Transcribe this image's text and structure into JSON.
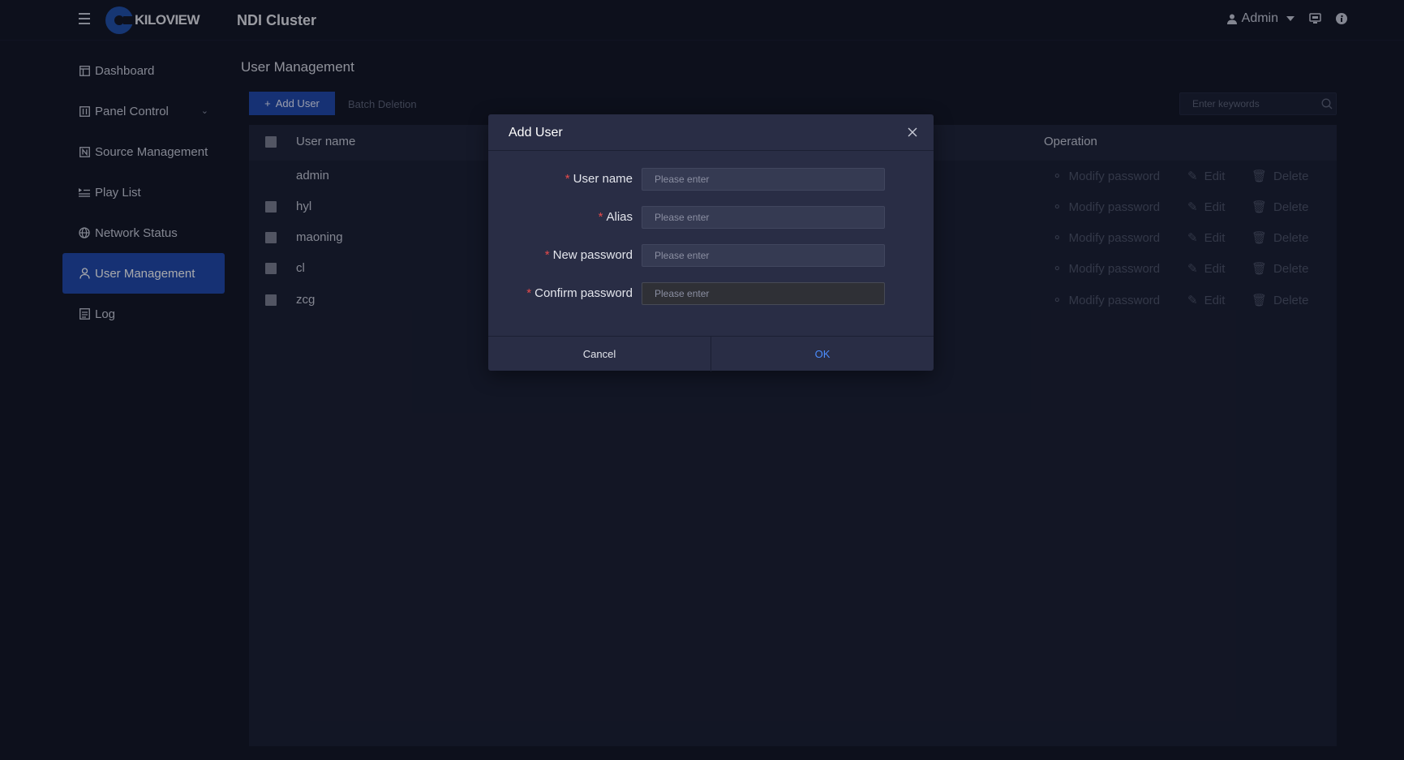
{
  "header": {
    "logo_text": "KILOVIEW",
    "app_title": "NDI Cluster",
    "user_label": "Admin"
  },
  "sidebar": {
    "items": [
      {
        "label": "Dashboard",
        "icon": "dashboard-icon"
      },
      {
        "label": "Panel Control",
        "icon": "panel-icon",
        "has_submenu": true
      },
      {
        "label": "Source Management",
        "icon": "source-icon"
      },
      {
        "label": "Play List",
        "icon": "playlist-icon"
      },
      {
        "label": "Network Status",
        "icon": "globe-icon"
      },
      {
        "label": "User Management",
        "icon": "user-icon",
        "active": true
      },
      {
        "label": "Log",
        "icon": "log-icon"
      }
    ]
  },
  "main": {
    "page_title": "User Management",
    "add_user_label": "Add User",
    "batch_delete_label": "Batch Deletion",
    "search_placeholder": "Enter keywords",
    "columns": {
      "user_name": "User name",
      "operation": "Operation"
    },
    "rows": [
      {
        "name": "admin",
        "has_checkbox": false
      },
      {
        "name": "hyl",
        "has_checkbox": true
      },
      {
        "name": "maoning",
        "has_checkbox": true
      },
      {
        "name": "cl",
        "has_checkbox": true
      },
      {
        "name": "zcg",
        "has_checkbox": true
      }
    ],
    "row_actions": {
      "modify_password": "Modify password",
      "edit": "Edit",
      "delete": "Delete"
    }
  },
  "dialog": {
    "title": "Add User",
    "required_mark": "*",
    "fields": [
      {
        "label": "User name",
        "placeholder": "Please enter",
        "value": ""
      },
      {
        "label": "Alias",
        "placeholder": "Please enter",
        "value": ""
      },
      {
        "label": "New password",
        "placeholder": "Please enter",
        "value": ""
      },
      {
        "label": "Confirm password",
        "placeholder": "Please enter",
        "value": ""
      }
    ],
    "cancel_label": "Cancel",
    "ok_label": "OK"
  },
  "colors": {
    "background": "#111422",
    "accent": "#1f47a9",
    "ok_text": "#4c8dff",
    "required": "#e64a4a"
  }
}
